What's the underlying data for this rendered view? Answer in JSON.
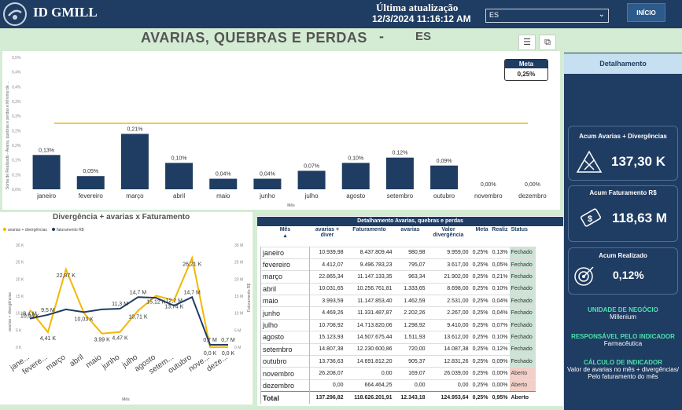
{
  "header": {
    "brand": "ID GMILL",
    "last_update_label": "Última atualização",
    "last_update_value": "12/3/2024 11:16:12 AM",
    "department": "ES",
    "home_button": "INÍCIO"
  },
  "page": {
    "title": "AVARIAS, QUEBRAS E PERDAS",
    "title_dash": "-",
    "title_dept": "ES"
  },
  "meta_card": {
    "label": "Meta",
    "value": "0,25%"
  },
  "chart_data": [
    {
      "type": "bar",
      "title": "",
      "xlabel": "Mês",
      "ylabel": "Soma de Realizado - Avaria, quebras e perdas e Mínimo de ...",
      "categories": [
        "janeiro",
        "fevereiro",
        "março",
        "abril",
        "maio",
        "junho",
        "julho",
        "agosto",
        "setembro",
        "outubro",
        "novembro",
        "dezembro"
      ],
      "values": [
        0.13,
        0.05,
        0.21,
        0.1,
        0.04,
        0.04,
        0.07,
        0.1,
        0.12,
        0.09,
        0.0,
        0.0
      ],
      "value_labels": [
        "0,13%",
        "0,05%",
        "0,21%",
        "0,10%",
        "0,04%",
        "0,04%",
        "0,07%",
        "0,10%",
        "0,12%",
        "0,09%",
        "0,00%",
        "0,00%"
      ],
      "meta_line": 0.25,
      "meta_color": "#f2b705",
      "bar_color": "#1f3c62",
      "y_ticks": [
        "0,0%",
        "0,1%",
        "0,1%",
        "0,2%",
        "0,2%",
        "0,3%",
        "0,3%",
        "0,4%",
        "0,4%",
        "0,5%"
      ],
      "ylim": [
        0,
        0.5
      ]
    },
    {
      "type": "line",
      "title": "Divergência + avarias x Faturamento",
      "xlabel": "Mês",
      "ylabel_left": "avarias + divergências",
      "ylabel_right": "Faturamento R$",
      "categories": [
        "jane...",
        "fevere...",
        "março",
        "abril",
        "maio",
        "junho",
        "julho",
        "agosto",
        "setem...",
        "outubro",
        "nove...",
        "deze..."
      ],
      "series": [
        {
          "name": "avarias + divergências",
          "color": "#f2b705",
          "values": [
            10.94,
            4.41,
            22.87,
            10.03,
            3.99,
            4.47,
            10.71,
            15.12,
            13.74,
            26.21,
            0.0,
            0.0
          ],
          "labels": [
            "10,94 K",
            "4,41 K",
            "22,87 K",
            "10,03 K",
            "3,99 K",
            "4,47 K",
            "10,71 K",
            "15,12 K",
            "13,74 K",
            "26,21 K",
            "0,0 K",
            "0,0 K"
          ]
        },
        {
          "name": "faturamento R$",
          "color": "#1f3c62",
          "values": [
            8.4,
            9.5,
            11.1,
            10.3,
            11.1,
            11.3,
            14.7,
            14.5,
            12.2,
            14.7,
            0.7,
            0.7
          ],
          "labels": [
            "8,4 M",
            "9,5 M",
            "",
            "",
            "",
            "11,3 M",
            "14,7 M",
            "",
            "12,2 M",
            "14,7 M",
            "0,7 M",
            "0,7 M"
          ]
        }
      ],
      "y_ticks_left": [
        "0 K",
        "5 K",
        "10 K",
        "15 K",
        "20 K",
        "25 K",
        "30 K"
      ],
      "y_ticks_right": [
        "0 M",
        "5 M",
        "10 M",
        "15 M",
        "20 M",
        "25 M",
        "30 M"
      ]
    }
  ],
  "sidebar": {
    "detail_button": "Detalhamento",
    "kpis": [
      {
        "label": "Acum Avarias + Divergências",
        "value": "137,30 K"
      },
      {
        "label": "Acum Faturamento R$",
        "value": "118,63 M"
      },
      {
        "label": "Acum Realizado",
        "value": "0,12%"
      }
    ],
    "business_unit_label": "UNIDADE DE NEGÓCIO",
    "business_unit_value": "Millenium",
    "responsible_label": "RESPONSÁVEL PELO INDICADOR",
    "responsible_value": "Farmacêutica",
    "calc_label": "CÁLCULO DE INDICADOR",
    "calc_value": "Valor de avarias no mês + divergências/ Pelo faturamento do mês"
  },
  "table": {
    "title": "Detalhamento Avarias, quebras e perdas",
    "headers": [
      "Mês",
      "avarias + diver",
      "Faturamento",
      "avarias",
      "Valor divergência",
      "Meta",
      "Realiz",
      "Status"
    ],
    "rows": [
      [
        "janeiro",
        "10.939,98",
        "8.437.809,44",
        "980,98",
        "9.959,00",
        "0,25%",
        "0,13%",
        "Fechado"
      ],
      [
        "fevereiro",
        "4.412,07",
        "9.496.783,23",
        "795,07",
        "3.617,00",
        "0,25%",
        "0,05%",
        "Fechado"
      ],
      [
        "março",
        "22.865,34",
        "11.147.133,35",
        "963,34",
        "21.902,00",
        "0,25%",
        "0,21%",
        "Fechado"
      ],
      [
        "abril",
        "10.031,65",
        "10.256.761,81",
        "1.333,65",
        "8.698,00",
        "0,25%",
        "0,10%",
        "Fechado"
      ],
      [
        "maio",
        "3.993,59",
        "11.147.853,40",
        "1.462,59",
        "2.531,00",
        "0,25%",
        "0,04%",
        "Fechado"
      ],
      [
        "junho",
        "4.469,26",
        "11.331.487,87",
        "2.202,26",
        "2.267,00",
        "0,25%",
        "0,04%",
        "Fechado"
      ],
      [
        "julho",
        "10.708,92",
        "14.713.820,06",
        "1.298,92",
        "9.410,00",
        "0,25%",
        "0,07%",
        "Fechado"
      ],
      [
        "agosto",
        "15.123,93",
        "14.507.675,44",
        "1.511,93",
        "13.612,00",
        "0,25%",
        "0,10%",
        "Fechado"
      ],
      [
        "setembro",
        "14.807,38",
        "12.230.600,86",
        "720,00",
        "14.087,38",
        "0,25%",
        "0,12%",
        "Fechado"
      ],
      [
        "outubro",
        "13.736,63",
        "14.691.812,20",
        "905,37",
        "12.831,26",
        "0,25%",
        "0,09%",
        "Fechado"
      ],
      [
        "novembro",
        "26.208,07",
        "0,00",
        "169,07",
        "26.039,00",
        "0,25%",
        "0,00%",
        "Aberto"
      ],
      [
        "dezembro",
        "0,00",
        "664.464,25",
        "0,00",
        "0,00",
        "0,25%",
        "0,00%",
        "Aberto"
      ]
    ],
    "total": [
      "Total",
      "137.296,82",
      "118.626.201,91",
      "12.343,18",
      "124.953,64",
      "0,25%",
      "0,95%",
      "Aberto"
    ]
  }
}
